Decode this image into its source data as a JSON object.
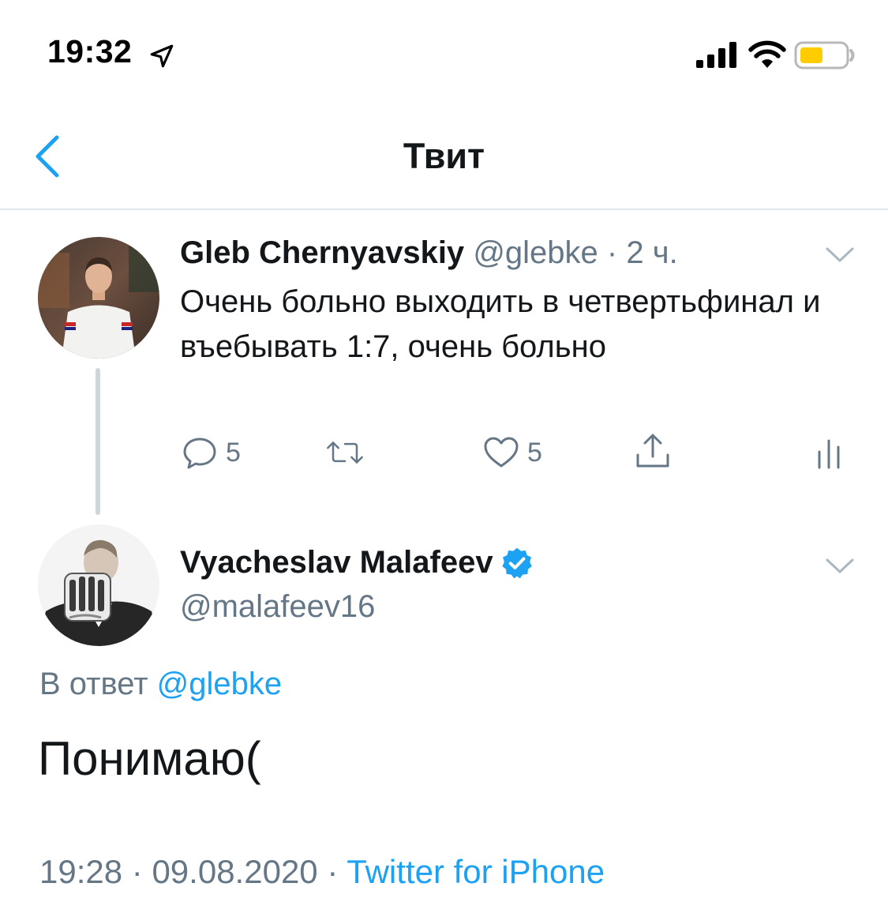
{
  "status_bar": {
    "time": "19:32",
    "icons": [
      "location-arrow-icon",
      "cellular-signal-icon",
      "wifi-icon",
      "battery-icon"
    ],
    "battery_color": "#ffcc00"
  },
  "nav": {
    "title": "Твит",
    "back_icon": "chevron-left-icon"
  },
  "colors": {
    "accent": "#1da1f2",
    "muted": "#657786",
    "text": "#14171a",
    "divider": "#e1e8ed",
    "thread_line": "#ccd6dd"
  },
  "parent_tweet": {
    "name": "Gleb Chernyavskiy",
    "handle": "@glebke",
    "separator": "·",
    "time_ago": "2 ч.",
    "text": "Очень больно выходить в четвертьфинал и въебывать 1:7, очень больно",
    "actions": {
      "replies": "5",
      "likes": "5"
    }
  },
  "main_tweet": {
    "name": "Vyacheslav Malafeev",
    "verified": true,
    "handle": "@malafeev16",
    "reply_prefix": "В ответ",
    "reply_handle": "@glebke",
    "text": "Понимаю(",
    "time": "19:28",
    "date": "09.08.2020",
    "sep": "·",
    "source": "Twitter for iPhone"
  }
}
